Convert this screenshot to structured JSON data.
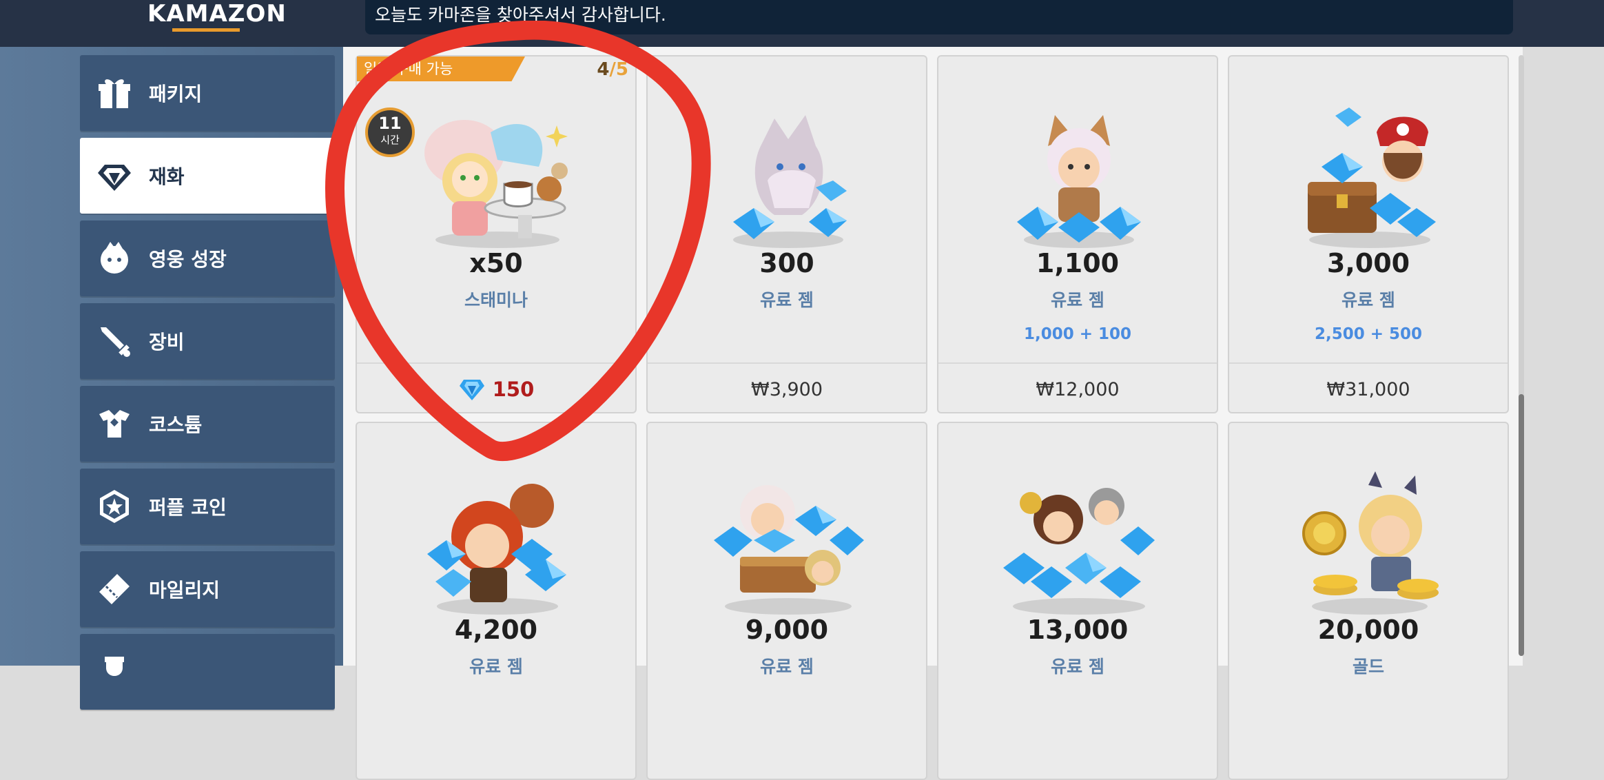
{
  "header": {
    "logo_text": "KAMAZON",
    "notice": "오늘도 카마존을 찾아주셔서 감사합니다."
  },
  "sidebar": {
    "items": [
      {
        "label": "패키지",
        "icon": "gift-icon"
      },
      {
        "label": "재화",
        "icon": "diamond-icon",
        "active": true
      },
      {
        "label": "영웅 성장",
        "icon": "hero-face-icon"
      },
      {
        "label": "장비",
        "icon": "sword-icon"
      },
      {
        "label": "코스튬",
        "icon": "costume-icon"
      },
      {
        "label": "퍼플 코인",
        "icon": "purple-coin-icon"
      },
      {
        "label": "마일리지",
        "icon": "ticket-icon"
      },
      {
        "label": "",
        "icon": "trophy-icon"
      }
    ]
  },
  "shop": {
    "products": [
      {
        "qty": "x50",
        "name": "스태미나",
        "bonus": "",
        "price": "150",
        "price_type": "gem",
        "badge": "일일 구매 가능",
        "counter_current": "4",
        "counter_max": "/5",
        "timer_value": "11",
        "timer_unit": "시간"
      },
      {
        "qty": "300",
        "name": "유료 젬",
        "bonus": "",
        "price": "₩3,900",
        "price_type": "krw"
      },
      {
        "qty": "1,100",
        "name": "유료 젬",
        "bonus": "1,000 + 100",
        "price": "₩12,000",
        "price_type": "krw"
      },
      {
        "qty": "3,000",
        "name": "유료 젬",
        "bonus": "2,500 + 500",
        "price": "₩31,000",
        "price_type": "krw"
      },
      {
        "qty": "4,200",
        "name": "유료 젬"
      },
      {
        "qty": "9,000",
        "name": "유료 젬"
      },
      {
        "qty": "13,000",
        "name": "유료 젬"
      },
      {
        "qty": "20,000",
        "name": "골드"
      }
    ]
  },
  "colors": {
    "header_bg": "#263246",
    "accent_orange": "#ee9a2a",
    "annotation_red": "#e8362a",
    "gem_blue": "#38a8ee"
  }
}
